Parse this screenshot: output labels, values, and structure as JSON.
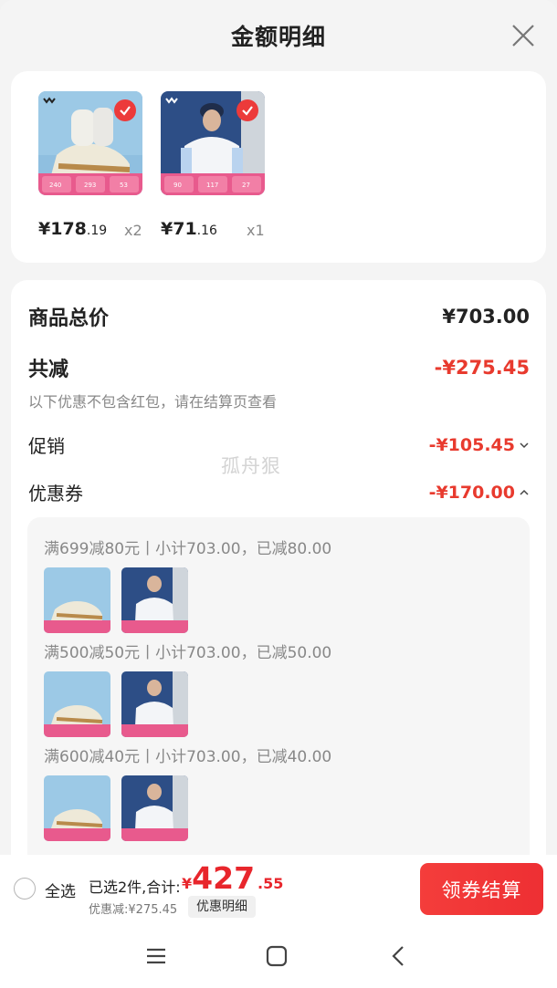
{
  "header": {
    "title": "金额明细"
  },
  "products": [
    {
      "price_int": "¥178",
      "price_dec": ".19",
      "qty": "x2",
      "badge_nums": [
        "240",
        "293",
        "53"
      ]
    },
    {
      "price_int": "¥71",
      "price_dec": ".16",
      "qty": "x1",
      "badge_nums": [
        "90",
        "117",
        "27"
      ]
    }
  ],
  "summary": {
    "goods_total_label": "商品总价",
    "goods_total_value": "¥703.00",
    "reduce_label": "共减",
    "reduce_value": "-¥275.45",
    "note": "以下优惠不包含红包，请在结算页查看",
    "promo_label": "促销",
    "promo_value": "-¥105.45",
    "coupon_label": "优惠券",
    "coupon_value": "-¥170.00",
    "watermark": "孤舟狠"
  },
  "coupons": [
    {
      "title": "满699减80元丨小计703.00，已减80.00"
    },
    {
      "title": "满500减50元丨小计703.00，已减50.00"
    },
    {
      "title": "满600减40元丨小计703.00，已减40.00"
    }
  ],
  "bottom": {
    "select_all": "全选",
    "selected": "已选2件,合计:",
    "total_yen": "¥",
    "total_int": "427",
    "total_dec": ".55",
    "discount": "优惠减:¥275.45",
    "detail_btn": "优惠明细",
    "checkout": "领券结算"
  },
  "colors": {
    "accent": "#e83a2e",
    "button": "#f43d3b"
  },
  "icons": [
    "close-icon",
    "check-icon",
    "chevron-down-icon",
    "chevron-up-icon",
    "menu-icon",
    "home-icon",
    "back-icon"
  ]
}
